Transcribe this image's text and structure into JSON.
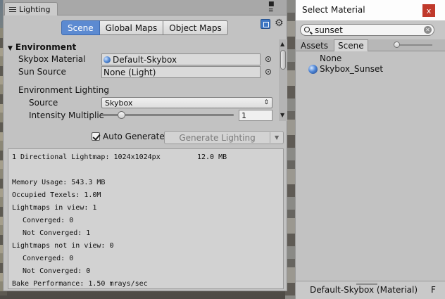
{
  "lighting": {
    "tab_title": "Lighting",
    "modes": [
      "Scene",
      "Global Maps",
      "Object Maps"
    ],
    "environment": {
      "heading": "Environment",
      "skybox_label": "Skybox Material",
      "skybox_value": "Default-Skybox",
      "sun_label": "Sun Source",
      "sun_value": "None (Light)",
      "env_lighting_label": "Environment Lighting",
      "source_label": "Source",
      "source_value": "Skybox",
      "intensity_label": "Intensity Multiplie",
      "intensity_value": "1",
      "intensity_fraction": 0.13
    },
    "auto_generate_label": "Auto Generate",
    "auto_generate_checked": true,
    "generate_button_label": "Generate Lighting",
    "stats": {
      "lightmap_line": "1 Directional Lightmap: 1024x1024px",
      "lightmap_size": "12.0 MB",
      "memory": "Memory Usage: 543.3 MB",
      "texels": "Occupied Texels: 1.0M",
      "in_view": "Lightmaps in view: 1",
      "in_view_converged": "Converged: 0",
      "in_view_not_converged": "Not Converged: 1",
      "not_in_view": "Lightmaps not in view: 0",
      "not_in_view_converged": "Converged: 0",
      "not_in_view_not_converged": "Not Converged: 0",
      "bake_perf": "Bake Performance: 1.50 mrays/sec"
    }
  },
  "select_material": {
    "title": "Select Material",
    "close_label": "x",
    "search_value": "sunset",
    "tabs": [
      "Assets",
      "Scene"
    ],
    "active_tab": "Scene",
    "items": [
      "None",
      "Skybox_Sunset"
    ],
    "footer": "Default-Skybox (Material)",
    "footer_extra": "F"
  },
  "colors": {
    "accent": "#5c8ad1",
    "close": "#c0392b"
  }
}
